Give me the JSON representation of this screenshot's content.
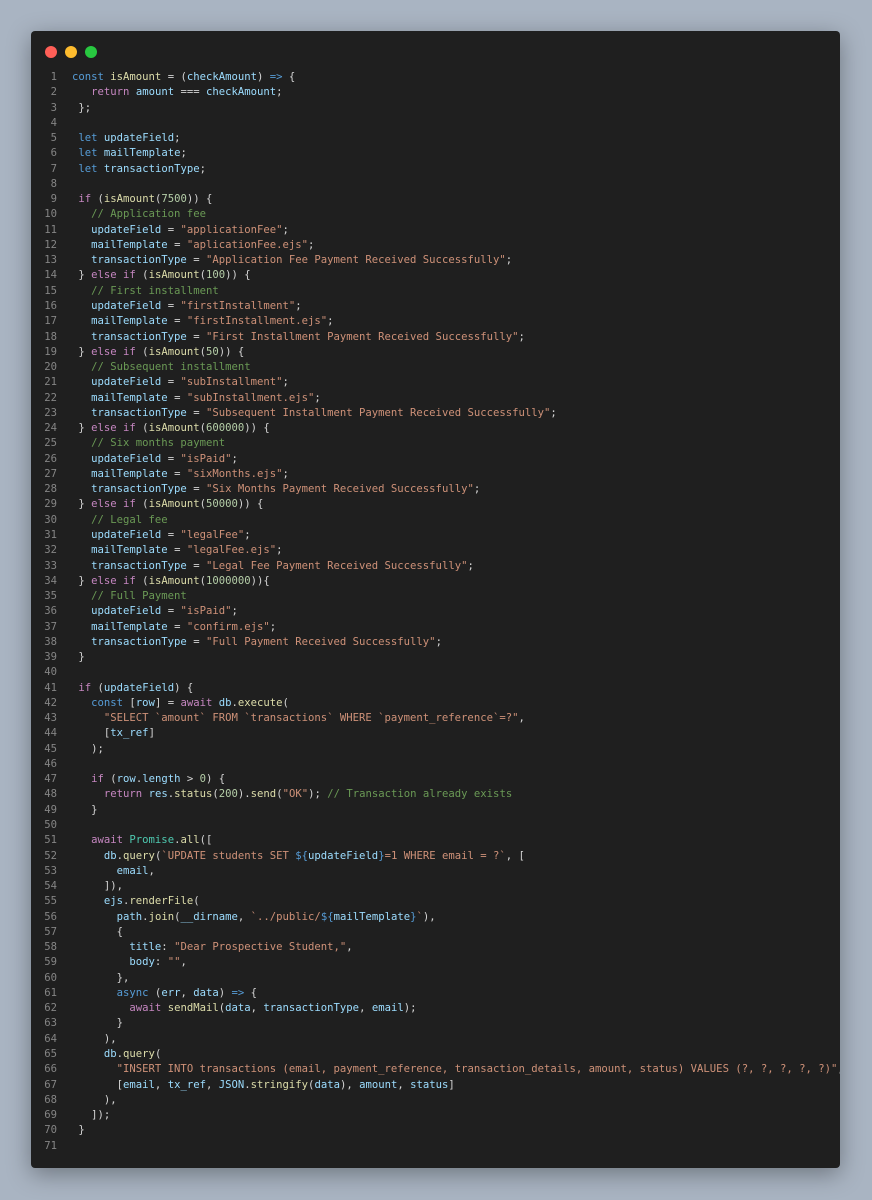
{
  "window": {
    "controls": [
      "close",
      "minimize",
      "maximize"
    ]
  },
  "colors": {
    "background": "#a9b4c2",
    "editor_bg": "#1f1f1f",
    "close": "#ff5f57",
    "minimize": "#febc2e",
    "maximize": "#28c840",
    "line_number": "#858585",
    "keyword": "#569cd6",
    "control": "#c586c0",
    "function": "#dcdcaa",
    "variable": "#9cdcfe",
    "string": "#ce9178",
    "number": "#b5cea8",
    "comment": "#6a9955",
    "class": "#4ec9b0",
    "plain": "#d4d4d4"
  },
  "code": {
    "lines": [
      [
        [
          "kw",
          "const"
        ],
        [
          "pl",
          " "
        ],
        [
          "fn",
          "isAmount"
        ],
        [
          "pl",
          " = ("
        ],
        [
          "var",
          "checkAmount"
        ],
        [
          "pl",
          ") "
        ],
        [
          "kw",
          "=>"
        ],
        [
          "pl",
          " {"
        ]
      ],
      [
        [
          "pl",
          "   "
        ],
        [
          "ctl",
          "return"
        ],
        [
          "pl",
          " "
        ],
        [
          "var",
          "amount"
        ],
        [
          "pl",
          " === "
        ],
        [
          "var",
          "checkAmount"
        ],
        [
          "pl",
          ";"
        ]
      ],
      [
        [
          "pl",
          " };"
        ]
      ],
      [],
      [
        [
          "pl",
          " "
        ],
        [
          "kw",
          "let"
        ],
        [
          "pl",
          " "
        ],
        [
          "var",
          "updateField"
        ],
        [
          "pl",
          ";"
        ]
      ],
      [
        [
          "pl",
          " "
        ],
        [
          "kw",
          "let"
        ],
        [
          "pl",
          " "
        ],
        [
          "var",
          "mailTemplate"
        ],
        [
          "pl",
          ";"
        ]
      ],
      [
        [
          "pl",
          " "
        ],
        [
          "kw",
          "let"
        ],
        [
          "pl",
          " "
        ],
        [
          "var",
          "transactionType"
        ],
        [
          "pl",
          ";"
        ]
      ],
      [],
      [
        [
          "pl",
          " "
        ],
        [
          "ctl",
          "if"
        ],
        [
          "pl",
          " ("
        ],
        [
          "fn",
          "isAmount"
        ],
        [
          "pl",
          "("
        ],
        [
          "num",
          "7500"
        ],
        [
          "pl",
          ")) {"
        ]
      ],
      [
        [
          "pl",
          "   "
        ],
        [
          "cm",
          "// Application fee"
        ]
      ],
      [
        [
          "pl",
          "   "
        ],
        [
          "var",
          "updateField"
        ],
        [
          "pl",
          " = "
        ],
        [
          "str",
          "\"applicationFee\""
        ],
        [
          "pl",
          ";"
        ]
      ],
      [
        [
          "pl",
          "   "
        ],
        [
          "var",
          "mailTemplate"
        ],
        [
          "pl",
          " = "
        ],
        [
          "str",
          "\"aplicationFee.ejs\""
        ],
        [
          "pl",
          ";"
        ]
      ],
      [
        [
          "pl",
          "   "
        ],
        [
          "var",
          "transactionType"
        ],
        [
          "pl",
          " = "
        ],
        [
          "str",
          "\"Application Fee Payment Received Successfully\""
        ],
        [
          "pl",
          ";"
        ]
      ],
      [
        [
          "pl",
          " } "
        ],
        [
          "ctl",
          "else if"
        ],
        [
          "pl",
          " ("
        ],
        [
          "fn",
          "isAmount"
        ],
        [
          "pl",
          "("
        ],
        [
          "num",
          "100"
        ],
        [
          "pl",
          ")) {"
        ]
      ],
      [
        [
          "pl",
          "   "
        ],
        [
          "cm",
          "// First installment"
        ]
      ],
      [
        [
          "pl",
          "   "
        ],
        [
          "var",
          "updateField"
        ],
        [
          "pl",
          " = "
        ],
        [
          "str",
          "\"firstInstallment\""
        ],
        [
          "pl",
          ";"
        ]
      ],
      [
        [
          "pl",
          "   "
        ],
        [
          "var",
          "mailTemplate"
        ],
        [
          "pl",
          " = "
        ],
        [
          "str",
          "\"firstInstallment.ejs\""
        ],
        [
          "pl",
          ";"
        ]
      ],
      [
        [
          "pl",
          "   "
        ],
        [
          "var",
          "transactionType"
        ],
        [
          "pl",
          " = "
        ],
        [
          "str",
          "\"First Installment Payment Received Successfully\""
        ],
        [
          "pl",
          ";"
        ]
      ],
      [
        [
          "pl",
          " } "
        ],
        [
          "ctl",
          "else if"
        ],
        [
          "pl",
          " ("
        ],
        [
          "fn",
          "isAmount"
        ],
        [
          "pl",
          "("
        ],
        [
          "num",
          "50"
        ],
        [
          "pl",
          ")) {"
        ]
      ],
      [
        [
          "pl",
          "   "
        ],
        [
          "cm",
          "// Subsequent installment"
        ]
      ],
      [
        [
          "pl",
          "   "
        ],
        [
          "var",
          "updateField"
        ],
        [
          "pl",
          " = "
        ],
        [
          "str",
          "\"subInstallment\""
        ],
        [
          "pl",
          ";"
        ]
      ],
      [
        [
          "pl",
          "   "
        ],
        [
          "var",
          "mailTemplate"
        ],
        [
          "pl",
          " = "
        ],
        [
          "str",
          "\"subInstallment.ejs\""
        ],
        [
          "pl",
          ";"
        ]
      ],
      [
        [
          "pl",
          "   "
        ],
        [
          "var",
          "transactionType"
        ],
        [
          "pl",
          " = "
        ],
        [
          "str",
          "\"Subsequent Installment Payment Received Successfully\""
        ],
        [
          "pl",
          ";"
        ]
      ],
      [
        [
          "pl",
          " } "
        ],
        [
          "ctl",
          "else if"
        ],
        [
          "pl",
          " ("
        ],
        [
          "fn",
          "isAmount"
        ],
        [
          "pl",
          "("
        ],
        [
          "num",
          "600000"
        ],
        [
          "pl",
          ")) {"
        ]
      ],
      [
        [
          "pl",
          "   "
        ],
        [
          "cm",
          "// Six months payment"
        ]
      ],
      [
        [
          "pl",
          "   "
        ],
        [
          "var",
          "updateField"
        ],
        [
          "pl",
          " = "
        ],
        [
          "str",
          "\"isPaid\""
        ],
        [
          "pl",
          ";"
        ]
      ],
      [
        [
          "pl",
          "   "
        ],
        [
          "var",
          "mailTemplate"
        ],
        [
          "pl",
          " = "
        ],
        [
          "str",
          "\"sixMonths.ejs\""
        ],
        [
          "pl",
          ";"
        ]
      ],
      [
        [
          "pl",
          "   "
        ],
        [
          "var",
          "transactionType"
        ],
        [
          "pl",
          " = "
        ],
        [
          "str",
          "\"Six Months Payment Received Successfully\""
        ],
        [
          "pl",
          ";"
        ]
      ],
      [
        [
          "pl",
          " } "
        ],
        [
          "ctl",
          "else if"
        ],
        [
          "pl",
          " ("
        ],
        [
          "fn",
          "isAmount"
        ],
        [
          "pl",
          "("
        ],
        [
          "num",
          "50000"
        ],
        [
          "pl",
          ")) {"
        ]
      ],
      [
        [
          "pl",
          "   "
        ],
        [
          "cm",
          "// Legal fee"
        ]
      ],
      [
        [
          "pl",
          "   "
        ],
        [
          "var",
          "updateField"
        ],
        [
          "pl",
          " = "
        ],
        [
          "str",
          "\"legalFee\""
        ],
        [
          "pl",
          ";"
        ]
      ],
      [
        [
          "pl",
          "   "
        ],
        [
          "var",
          "mailTemplate"
        ],
        [
          "pl",
          " = "
        ],
        [
          "str",
          "\"legalFee.ejs\""
        ],
        [
          "pl",
          ";"
        ]
      ],
      [
        [
          "pl",
          "   "
        ],
        [
          "var",
          "transactionType"
        ],
        [
          "pl",
          " = "
        ],
        [
          "str",
          "\"Legal Fee Payment Received Successfully\""
        ],
        [
          "pl",
          ";"
        ]
      ],
      [
        [
          "pl",
          " } "
        ],
        [
          "ctl",
          "else if"
        ],
        [
          "pl",
          " ("
        ],
        [
          "fn",
          "isAmount"
        ],
        [
          "pl",
          "("
        ],
        [
          "num",
          "1000000"
        ],
        [
          "pl",
          ")){"
        ]
      ],
      [
        [
          "pl",
          "   "
        ],
        [
          "cm",
          "// Full Payment"
        ]
      ],
      [
        [
          "pl",
          "   "
        ],
        [
          "var",
          "updateField"
        ],
        [
          "pl",
          " = "
        ],
        [
          "str",
          "\"isPaid\""
        ],
        [
          "pl",
          ";"
        ]
      ],
      [
        [
          "pl",
          "   "
        ],
        [
          "var",
          "mailTemplate"
        ],
        [
          "pl",
          " = "
        ],
        [
          "str",
          "\"confirm.ejs\""
        ],
        [
          "pl",
          ";"
        ]
      ],
      [
        [
          "pl",
          "   "
        ],
        [
          "var",
          "transactionType"
        ],
        [
          "pl",
          " = "
        ],
        [
          "str",
          "\"Full Payment Received Successfully\""
        ],
        [
          "pl",
          ";"
        ]
      ],
      [
        [
          "pl",
          " }"
        ]
      ],
      [],
      [
        [
          "pl",
          " "
        ],
        [
          "ctl",
          "if"
        ],
        [
          "pl",
          " ("
        ],
        [
          "var",
          "updateField"
        ],
        [
          "pl",
          ") {"
        ]
      ],
      [
        [
          "pl",
          "   "
        ],
        [
          "kw",
          "const"
        ],
        [
          "pl",
          " ["
        ],
        [
          "var",
          "row"
        ],
        [
          "pl",
          "] = "
        ],
        [
          "ctl",
          "await"
        ],
        [
          "pl",
          " "
        ],
        [
          "var",
          "db"
        ],
        [
          "pl",
          "."
        ],
        [
          "fn",
          "execute"
        ],
        [
          "pl",
          "("
        ]
      ],
      [
        [
          "pl",
          "     "
        ],
        [
          "str",
          "\"SELECT `amount` FROM `transactions` WHERE `payment_reference`=?\""
        ],
        [
          "pl",
          ","
        ]
      ],
      [
        [
          "pl",
          "     ["
        ],
        [
          "var",
          "tx_ref"
        ],
        [
          "pl",
          "]"
        ]
      ],
      [
        [
          "pl",
          "   );"
        ]
      ],
      [],
      [
        [
          "pl",
          "   "
        ],
        [
          "ctl",
          "if"
        ],
        [
          "pl",
          " ("
        ],
        [
          "var",
          "row"
        ],
        [
          "pl",
          "."
        ],
        [
          "var",
          "length"
        ],
        [
          "pl",
          " > "
        ],
        [
          "num",
          "0"
        ],
        [
          "pl",
          ") {"
        ]
      ],
      [
        [
          "pl",
          "     "
        ],
        [
          "ctl",
          "return"
        ],
        [
          "pl",
          " "
        ],
        [
          "var",
          "res"
        ],
        [
          "pl",
          "."
        ],
        [
          "fn",
          "status"
        ],
        [
          "pl",
          "("
        ],
        [
          "num",
          "200"
        ],
        [
          "pl",
          ")."
        ],
        [
          "fn",
          "send"
        ],
        [
          "pl",
          "("
        ],
        [
          "str",
          "\"OK\""
        ],
        [
          "pl",
          "); "
        ],
        [
          "cm",
          "// Transaction already exists"
        ]
      ],
      [
        [
          "pl",
          "   }"
        ]
      ],
      [],
      [
        [
          "pl",
          "   "
        ],
        [
          "ctl",
          "await"
        ],
        [
          "pl",
          " "
        ],
        [
          "cls",
          "Promise"
        ],
        [
          "pl",
          "."
        ],
        [
          "fn",
          "all"
        ],
        [
          "pl",
          "(["
        ]
      ],
      [
        [
          "pl",
          "     "
        ],
        [
          "var",
          "db"
        ],
        [
          "pl",
          "."
        ],
        [
          "fn",
          "query"
        ],
        [
          "pl",
          "("
        ],
        [
          "str",
          "`UPDATE students SET "
        ],
        [
          "kw",
          "${"
        ],
        [
          "var",
          "updateField"
        ],
        [
          "kw",
          "}"
        ],
        [
          "str",
          "=1 WHERE email = ?`"
        ],
        [
          "pl",
          ", ["
        ]
      ],
      [
        [
          "pl",
          "       "
        ],
        [
          "var",
          "email"
        ],
        [
          "pl",
          ","
        ]
      ],
      [
        [
          "pl",
          "     ]),"
        ]
      ],
      [
        [
          "pl",
          "     "
        ],
        [
          "var",
          "ejs"
        ],
        [
          "pl",
          "."
        ],
        [
          "fn",
          "renderFile"
        ],
        [
          "pl",
          "("
        ]
      ],
      [
        [
          "pl",
          "       "
        ],
        [
          "var",
          "path"
        ],
        [
          "pl",
          "."
        ],
        [
          "fn",
          "join"
        ],
        [
          "pl",
          "("
        ],
        [
          "var",
          "__dirname"
        ],
        [
          "pl",
          ", "
        ],
        [
          "str",
          "`../public/"
        ],
        [
          "kw",
          "${"
        ],
        [
          "var",
          "mailTemplate"
        ],
        [
          "kw",
          "}"
        ],
        [
          "str",
          "`"
        ],
        [
          "pl",
          "),"
        ]
      ],
      [
        [
          "pl",
          "       {"
        ]
      ],
      [
        [
          "pl",
          "         "
        ],
        [
          "var",
          "title"
        ],
        [
          "pl",
          ": "
        ],
        [
          "str",
          "\"Dear Prospective Student,\""
        ],
        [
          "pl",
          ","
        ]
      ],
      [
        [
          "pl",
          "         "
        ],
        [
          "var",
          "body"
        ],
        [
          "pl",
          ": "
        ],
        [
          "str",
          "\"\""
        ],
        [
          "pl",
          ","
        ]
      ],
      [
        [
          "pl",
          "       },"
        ]
      ],
      [
        [
          "pl",
          "       "
        ],
        [
          "kw",
          "async"
        ],
        [
          "pl",
          " ("
        ],
        [
          "var",
          "err"
        ],
        [
          "pl",
          ", "
        ],
        [
          "var",
          "data"
        ],
        [
          "pl",
          ") "
        ],
        [
          "kw",
          "=>"
        ],
        [
          "pl",
          " {"
        ]
      ],
      [
        [
          "pl",
          "         "
        ],
        [
          "ctl",
          "await"
        ],
        [
          "pl",
          " "
        ],
        [
          "fn",
          "sendMail"
        ],
        [
          "pl",
          "("
        ],
        [
          "var",
          "data"
        ],
        [
          "pl",
          ", "
        ],
        [
          "var",
          "transactionType"
        ],
        [
          "pl",
          ", "
        ],
        [
          "var",
          "email"
        ],
        [
          "pl",
          ");"
        ]
      ],
      [
        [
          "pl",
          "       }"
        ]
      ],
      [
        [
          "pl",
          "     ),"
        ]
      ],
      [
        [
          "pl",
          "     "
        ],
        [
          "var",
          "db"
        ],
        [
          "pl",
          "."
        ],
        [
          "fn",
          "query"
        ],
        [
          "pl",
          "("
        ]
      ],
      [
        [
          "pl",
          "       "
        ],
        [
          "str",
          "\"INSERT INTO transactions (email, payment_reference, transaction_details, amount, status) VALUES (?, ?, ?, ?, ?)\""
        ],
        [
          "pl",
          ","
        ]
      ],
      [
        [
          "pl",
          "       ["
        ],
        [
          "var",
          "email"
        ],
        [
          "pl",
          ", "
        ],
        [
          "var",
          "tx_ref"
        ],
        [
          "pl",
          ", "
        ],
        [
          "var",
          "JSON"
        ],
        [
          "pl",
          "."
        ],
        [
          "fn",
          "stringify"
        ],
        [
          "pl",
          "("
        ],
        [
          "var",
          "data"
        ],
        [
          "pl",
          "), "
        ],
        [
          "var",
          "amount"
        ],
        [
          "pl",
          ", "
        ],
        [
          "var",
          "status"
        ],
        [
          "pl",
          "]"
        ]
      ],
      [
        [
          "pl",
          "     ),"
        ]
      ],
      [
        [
          "pl",
          "   ]);"
        ]
      ],
      [
        [
          "pl",
          " }"
        ]
      ],
      []
    ]
  }
}
